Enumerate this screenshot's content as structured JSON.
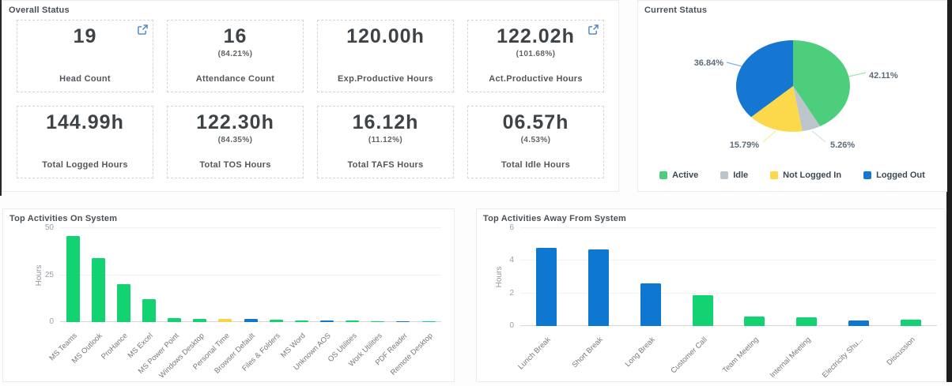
{
  "panels": {
    "overall_status": {
      "title": "Overall Status",
      "cards": [
        {
          "value": "19",
          "percent": "",
          "label": "Head Count",
          "has_expand_icon": true
        },
        {
          "value": "16",
          "percent": "(84.21%)",
          "label": "Attendance Count",
          "has_expand_icon": false
        },
        {
          "value": "120.00h",
          "percent": "",
          "label": "Exp.Productive Hours",
          "has_expand_icon": false
        },
        {
          "value": "122.02h",
          "percent": "(101.68%)",
          "label": "Act.Productive Hours",
          "has_expand_icon": true
        },
        {
          "value": "144.99h",
          "percent": "",
          "label": "Total Logged Hours",
          "has_expand_icon": false
        },
        {
          "value": "122.30h",
          "percent": "(84.35%)",
          "label": "Total TOS Hours",
          "has_expand_icon": false
        },
        {
          "value": "16.12h",
          "percent": "(11.12%)",
          "label": "Total TAFS Hours",
          "has_expand_icon": false
        },
        {
          "value": "06.57h",
          "percent": "(4.53%)",
          "label": "Total Idle Hours",
          "has_expand_icon": false
        }
      ]
    },
    "current_status": {
      "title": "Current Status"
    },
    "top_activities_on_system": {
      "title": "Top Activities On System"
    },
    "top_activities_away_from_system": {
      "title": "Top Activities Away From System"
    }
  },
  "chart_data": [
    {
      "type": "pie",
      "title": "Current Status",
      "labels": [
        "Active",
        "Idle",
        "Not Logged In",
        "Logged Out"
      ],
      "values": [
        42.11,
        5.26,
        15.79,
        36.84
      ],
      "value_labels": [
        "42.11%",
        "5.26%",
        "15.79%",
        "36.84%"
      ],
      "colors": [
        "#4dce7d",
        "#bdc5cc",
        "#fcd84b",
        "#1577d2"
      ],
      "legend_position": "bottom"
    },
    {
      "type": "bar",
      "title": "Top Activities On System",
      "xlabel": "",
      "ylabel": "Hours",
      "yticks": [
        0,
        25,
        50
      ],
      "ylim": [
        0,
        50
      ],
      "categories": [
        "MS Teams",
        "MS Outlook",
        "ProHance",
        "MS Excel",
        "MS Power Point",
        "Windows Desktop",
        "Personal Time",
        "Browser Default",
        "Files & Folders",
        "MS Word",
        "Unknown AOS",
        "OS Utilities",
        "Work Utilities",
        "PDF Reader",
        "Remote Desktop"
      ],
      "values": [
        46,
        34,
        20,
        12,
        2,
        1.5,
        1.5,
        1.5,
        1.4,
        0.9,
        1.0,
        0.9,
        0.3,
        0.25,
        0.3
      ],
      "bar_colors": [
        "#12d271",
        "#12d271",
        "#12d271",
        "#12d271",
        "#12d271",
        "#12d271",
        "#f8d348",
        "#0e77cf",
        "#12d271",
        "#12d271",
        "#0e77cf",
        "#12d271",
        "#12d271",
        "#0e77cf",
        "#12d271"
      ],
      "grid": true
    },
    {
      "type": "bar",
      "title": "Top Activities Away From System",
      "xlabel": "",
      "ylabel": "Hours",
      "yticks": [
        0,
        2,
        4,
        6
      ],
      "ylim": [
        0,
        6
      ],
      "categories": [
        "Lunch Break",
        "Short Break",
        "Long Break",
        "Customer Call",
        "Team Meeting",
        "Internal Meeting",
        "Electricity Shu...",
        "Discussion"
      ],
      "values": [
        4.8,
        4.7,
        2.6,
        1.9,
        0.6,
        0.55,
        0.35,
        0.4
      ],
      "bar_colors": [
        "#0e77cf",
        "#0e77cf",
        "#0e77cf",
        "#12d271",
        "#12d271",
        "#12d271",
        "#0e77cf",
        "#12d271"
      ],
      "grid": true
    }
  ],
  "colors": {
    "green": "#12d271",
    "blue": "#0e77cf",
    "yellow": "#f8d348",
    "gray": "#bdc5cc",
    "icon_blue": "#4a82bd"
  }
}
